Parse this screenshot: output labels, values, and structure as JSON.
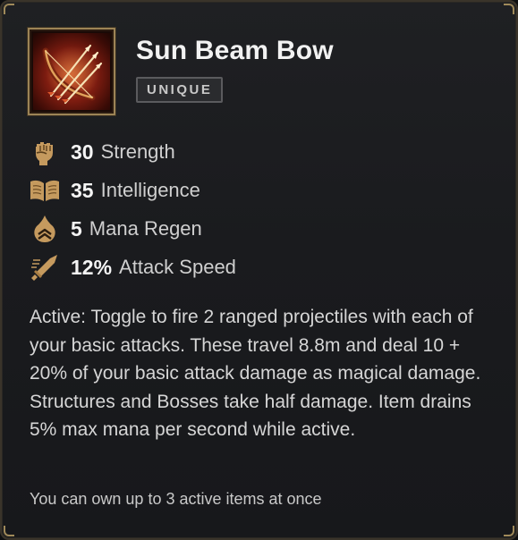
{
  "item": {
    "name": "Sun Beam Bow",
    "rarity": "UNIQUE",
    "icon": "sun-beam-bow-icon"
  },
  "stats": [
    {
      "value": "30",
      "label": "Strength",
      "icon": "fist-icon"
    },
    {
      "value": "35",
      "label": "Intelligence",
      "icon": "book-icon"
    },
    {
      "value": "5",
      "label": "Mana Regen",
      "icon": "mana-flame-icon"
    },
    {
      "value": "12%",
      "label": "Attack Speed",
      "icon": "sword-icon"
    }
  ],
  "description": "Active: Toggle to fire 2 ranged projectiles with each of your basic attacks. These travel 8.8m and deal 10 + 20% of your basic attack damage as magical damage. Structures and Bosses take half damage. Item drains 5% max mana per second while active.",
  "note": "You can own up to 3 active items at once",
  "colors": {
    "accent_gold": "#a08a5a",
    "icon_gold": "#c59a5e",
    "background": "#1c1d20"
  }
}
